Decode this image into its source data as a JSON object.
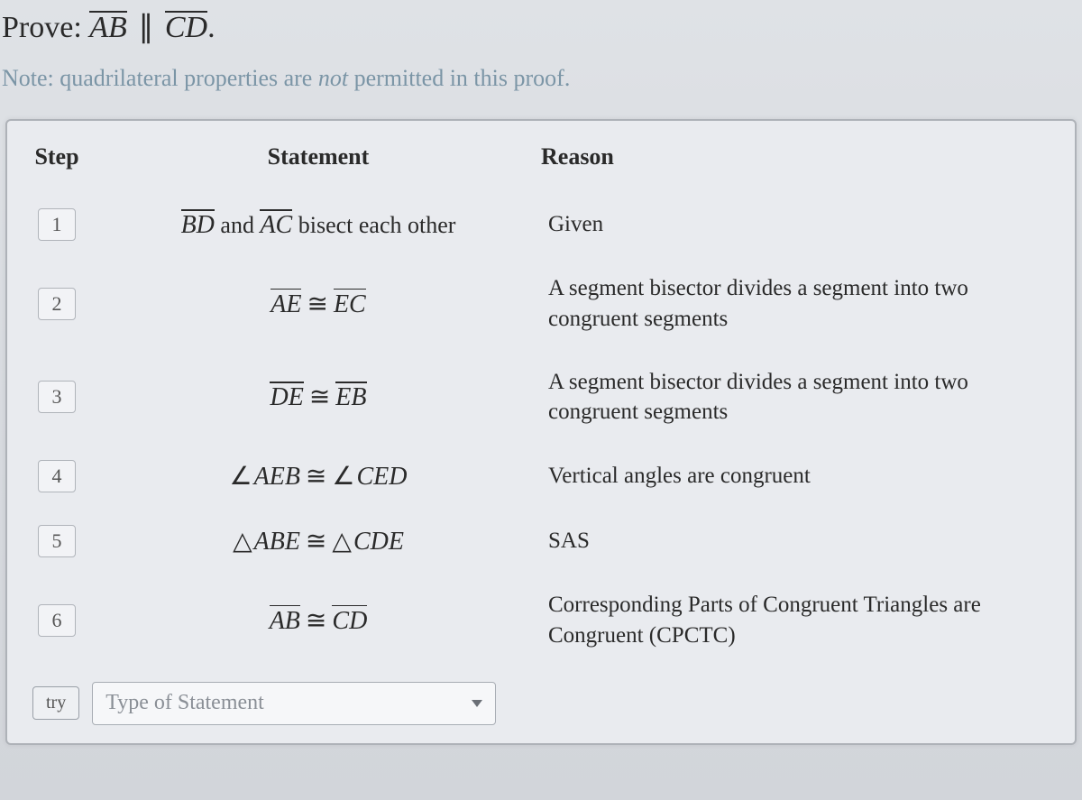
{
  "prove": {
    "label": "Prove:",
    "seg1": "AB",
    "parallel": "∥",
    "seg2": "CD",
    "period": "."
  },
  "note": {
    "prefix": "Note: quadrilateral properties are ",
    "italic": "not",
    "suffix": " permitted in this proof."
  },
  "headers": {
    "step": "Step",
    "statement": "Statement",
    "reason": "Reason"
  },
  "rows": [
    {
      "step": "1",
      "statement": {
        "kind": "bisect",
        "seg1": "BD",
        "mid": " and ",
        "seg2": "AC",
        "tail": " bisect each other"
      },
      "reason": "Given"
    },
    {
      "step": "2",
      "statement": {
        "kind": "segcong",
        "a": "AE",
        "b": "EC"
      },
      "reason": "A segment bisector divides a segment into two congruent segments"
    },
    {
      "step": "3",
      "statement": {
        "kind": "segcong",
        "a": "DE",
        "b": "EB"
      },
      "reason": "A segment bisector divides a segment into two congruent segments"
    },
    {
      "step": "4",
      "statement": {
        "kind": "anglecong",
        "a": "AEB",
        "b": "CED"
      },
      "reason": "Vertical angles are congruent"
    },
    {
      "step": "5",
      "statement": {
        "kind": "tricong",
        "a": "ABE",
        "b": "CDE"
      },
      "reason": "SAS"
    },
    {
      "step": "6",
      "statement": {
        "kind": "segcong",
        "a": "AB",
        "b": "CD"
      },
      "reason": "Corresponding Parts of Congruent Triangles are Congruent (CPCTC)"
    }
  ],
  "tryRow": {
    "button": "try",
    "placeholder": "Type of Statement"
  },
  "symbols": {
    "cong": "≅",
    "angle": "∠",
    "triangle": "△"
  }
}
